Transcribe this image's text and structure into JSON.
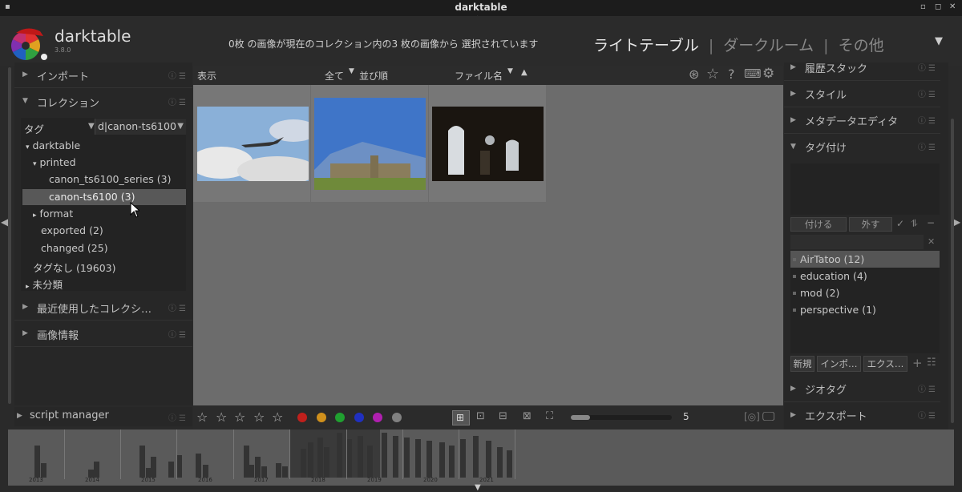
{
  "window": {
    "title": "darktable"
  },
  "header": {
    "app_name": "darktable",
    "app_version": "3.8.0",
    "status": "0枚 の画像が現在のコレクション内の3 枚の画像から 選択されています",
    "views": [
      "ライトテーブル",
      "ダークルーム",
      "その他"
    ],
    "view_sep": "|"
  },
  "left": {
    "modules": {
      "import": "インポート",
      "collection": "コレクション",
      "recent": "最近使用したコレクシ…",
      "image_info": "画像情報"
    },
    "collection": {
      "property": "タグ",
      "query": "d|canon-ts6100",
      "tree": [
        {
          "label": "darktable",
          "arrow": "▾"
        },
        {
          "label": "printed",
          "arrow": "▾"
        },
        {
          "label": "canon_ts6100_series (3)",
          "arrow": ""
        },
        {
          "label": "canon-ts6100 (3)",
          "arrow": ""
        },
        {
          "label": "format",
          "arrow": "▸"
        },
        {
          "label": "exported (2)",
          "arrow": ""
        },
        {
          "label": "changed (25)",
          "arrow": ""
        },
        {
          "label": "タグなし (19603)",
          "arrow": ""
        },
        {
          "label": "未分類",
          "arrow": "▸"
        }
      ]
    },
    "script_manager": "script manager"
  },
  "center": {
    "toolbar": {
      "show": "表示",
      "all": "全て",
      "sort": "並び順",
      "filename": "ファイル名"
    },
    "zoom_value": "5"
  },
  "right": {
    "modules": {
      "history": "履歴スタック",
      "styles": "スタイル",
      "metadata": "メタデータエディタ",
      "tagging": "タグ付け",
      "geotag": "ジオタグ",
      "export": "エクスポート"
    },
    "tagging": {
      "attach": "付ける",
      "detach": "外す",
      "tags": [
        "AirTatoo (12)",
        "education (4)",
        "mod (2)",
        "perspective (1)"
      ],
      "buttons": [
        "新規",
        "インポ…",
        "エクス…"
      ]
    }
  },
  "timeline": {
    "years": [
      "2013",
      "2014",
      "2015",
      "2016",
      "2017",
      "2018",
      "2019",
      "2020",
      "2021"
    ]
  },
  "colors": {
    "labels": [
      "#c0201c",
      "#d0901c",
      "#20a030",
      "#2030c0",
      "#b020b0",
      "#808080"
    ]
  }
}
